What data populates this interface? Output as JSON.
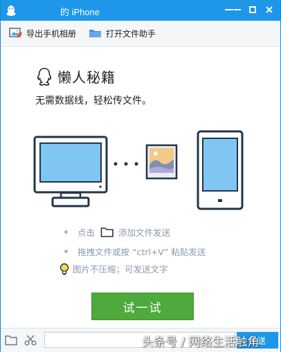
{
  "window": {
    "title": "的 iPhone",
    "controls": {
      "menu": "menu-icon",
      "minimize": "minimize-icon",
      "maximize": "maximize-icon",
      "close": "close-icon"
    },
    "colors": {
      "titlebar": "#1e97e8",
      "accent_green": "#4eaa3d",
      "tip_text": "#8a9aab"
    }
  },
  "toolbar": {
    "export_album": {
      "label": "导出手机相册",
      "icon": "export-album-icon"
    },
    "open_file_helper": {
      "label": "打开文件助手",
      "icon": "folder-icon"
    }
  },
  "main": {
    "headline": "懒人秘籍",
    "subtitle": "无需数据线，轻松传文件。",
    "tips": {
      "click_prefix": "点击",
      "click_suffix": "添加文件发送",
      "drag": "拖拽文件或按 “ctrl+V” 粘贴发送",
      "no_compress": "图片不压缩；可发送文字"
    },
    "try_button": "试一试"
  },
  "bottombar": {
    "folder_icon": "folder-icon",
    "scissors_icon": "scissors-icon",
    "input_value": "",
    "send_label": "发送"
  },
  "watermark": "头条号 / 网络生活触角"
}
